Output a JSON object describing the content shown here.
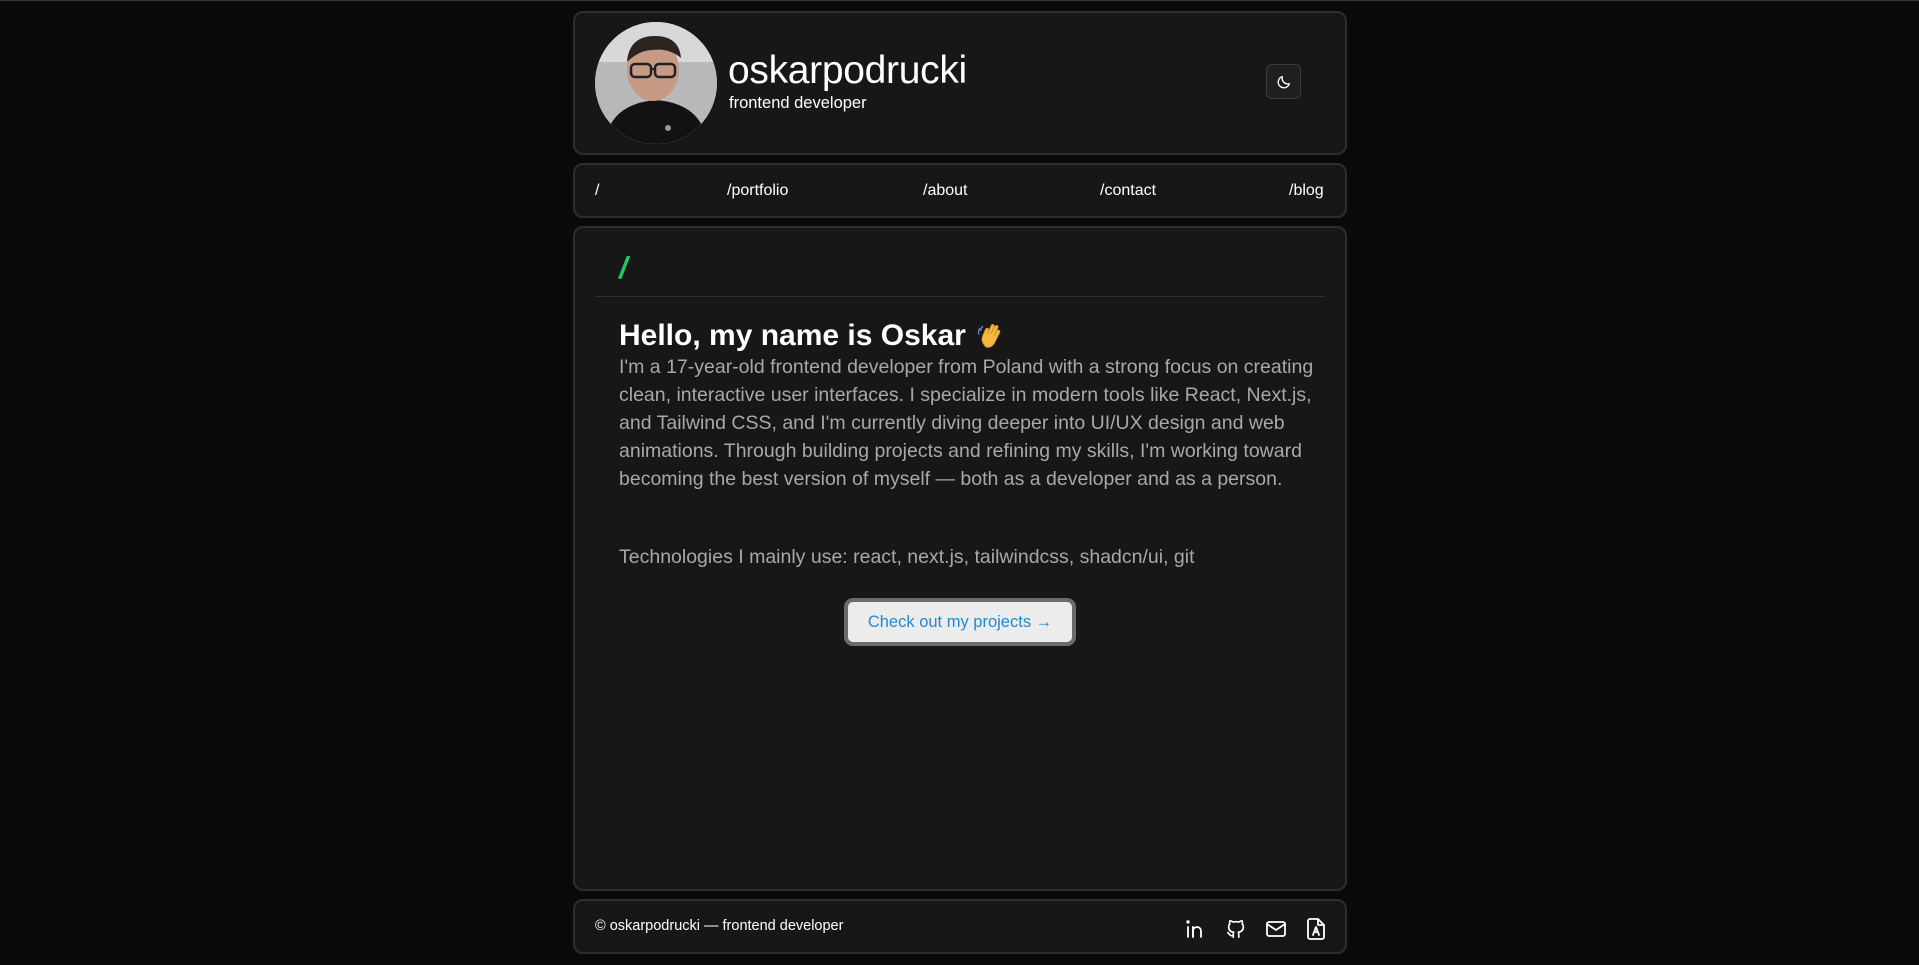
{
  "header": {
    "name": "oskarpodrucki",
    "role": "frontend developer",
    "avatar_alt": "avatar",
    "theme_toggle_icon": "moon-icon"
  },
  "nav": {
    "items": [
      {
        "label": "/"
      },
      {
        "label": "/portfolio"
      },
      {
        "label": "/about"
      },
      {
        "label": "/contact"
      },
      {
        "label": "/blog"
      }
    ]
  },
  "main": {
    "section_label": "/",
    "accent_color": "#22c55e",
    "greeting": "Hello, my name is Oskar",
    "greeting_icon": "waving-hand-icon",
    "bio": "I'm a 17-year-old frontend developer from Poland with a strong focus on creating clean, interactive user interfaces. I specialize in modern tools like React, Next.js, and Tailwind CSS, and I'm currently diving deeper into UI/UX design and web animations. Through building projects and refining my skills, I'm working toward becoming the best version of myself — both as a developer and as a person.",
    "technologies": "Technologies I mainly use: react, next.js, tailwindcss, shadcn/ui, git",
    "cta_label": "Check out my projects →",
    "cta_color": "#1f8ad2"
  },
  "footer": {
    "copyright": "© oskarpodrucki — frontend developer",
    "social_icons": [
      "linkedin-icon",
      "github-icon",
      "mail-icon",
      "resume-icon"
    ]
  }
}
